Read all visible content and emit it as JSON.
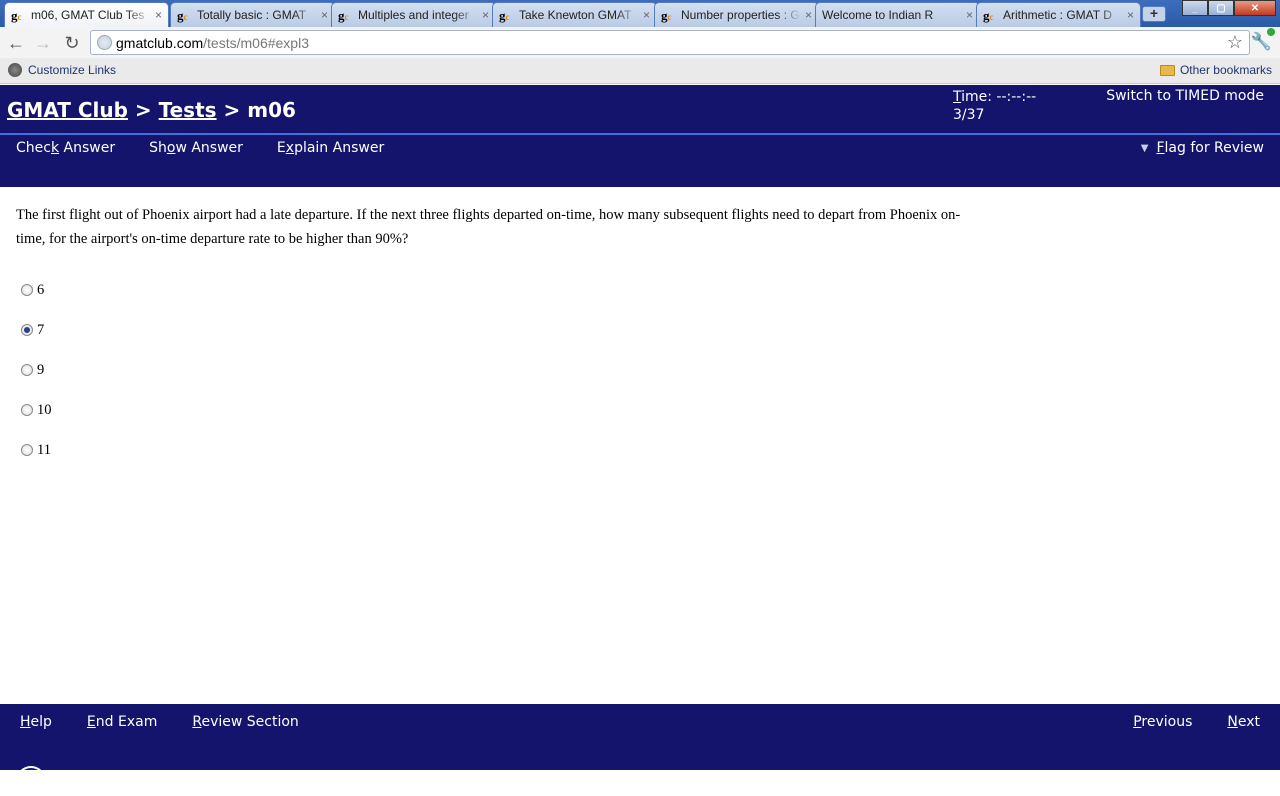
{
  "browser": {
    "tabs": [
      {
        "label": "m06, GMAT Club Tes",
        "favicon": "gc-icon",
        "active": true
      },
      {
        "label": "Totally basic : GMAT",
        "favicon": "gc-icon",
        "active": false
      },
      {
        "label": "Multiples and integer",
        "favicon": "gc-icon",
        "active": false
      },
      {
        "label": "Take Knewton GMAT",
        "favicon": "gc-icon",
        "active": false
      },
      {
        "label": "Number properties : G",
        "favicon": "gc-icon",
        "active": false
      },
      {
        "label": "Welcome to Indian R",
        "favicon": "flag-icon",
        "active": false
      },
      {
        "label": "Arithmetic : GMAT D",
        "favicon": "gc-icon",
        "active": false
      }
    ],
    "favicon_text": "g",
    "favicon_sub": "c",
    "tab_close": "×",
    "new_tab": "+",
    "url_host": "gmatclub.com",
    "url_path": "/tests/m06#expl3",
    "bookmark_left": "Customize Links",
    "bookmark_right": "Other bookmarks"
  },
  "header": {
    "crumb_1": "GMAT Club",
    "sep": " > ",
    "crumb_2": "Tests",
    "crumb_3": "m06",
    "timer_key": "T",
    "timer_rest": "ime: --:--:--",
    "progress": "3/37",
    "timed_mode": "Switch to TIMED mode",
    "actions": {
      "check_a": "Chec",
      "check_u": "k",
      "check_b": " Answer",
      "show_a": "Sh",
      "show_u": "o",
      "show_b": "w Answer",
      "explain_a": "E",
      "explain_u": "x",
      "explain_b": "plain Answer"
    },
    "flag_u": "F",
    "flag_rest": "lag for Review"
  },
  "question": {
    "text": "The first flight out of Phoenix airport had a late departure. If the next three flights departed on-time, how many subsequent flights need to depart from Phoenix on-time, for the airport's on-time departure rate to be higher than 90%?",
    "choices": [
      "6",
      "7",
      "9",
      "10",
      "11"
    ],
    "selected_index": 1
  },
  "footer": {
    "help_u": "H",
    "help_rest": "elp",
    "end_u": "E",
    "end_rest": "nd Exam",
    "review_u": "R",
    "review_rest": "eview Section",
    "prev_u": "P",
    "prev_rest": "revious",
    "next_u": "N",
    "next_rest": "ext"
  },
  "colors": {
    "header_bg": "#14146c",
    "header_divider": "#3f71d8",
    "text_on_dark": "#ffffff"
  }
}
